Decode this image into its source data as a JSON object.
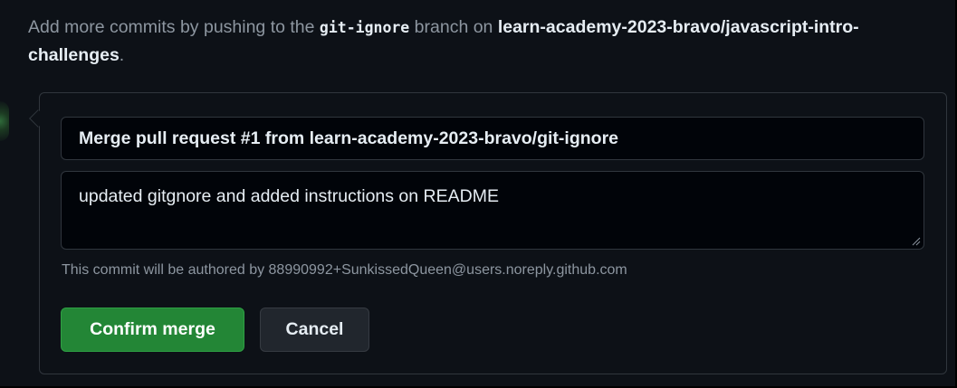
{
  "info": {
    "prefix": "Add more commits by pushing to the ",
    "branch": "git-ignore",
    "middle": " branch on ",
    "repo": "learn-academy-2023-bravo/javascript-intro-challenges",
    "suffix": "."
  },
  "merge_form": {
    "commit_title": "Merge pull request #1 from learn-academy-2023-bravo/git-ignore",
    "commit_message": "updated gitgnore and added instructions on README",
    "author_note": "This commit will be authored by 88990992+SunkissedQueen@users.noreply.github.com",
    "confirm_label": "Confirm merge",
    "cancel_label": "Cancel"
  },
  "colors": {
    "confirm_bg": "#238636",
    "cancel_bg": "#21262d",
    "page_bg": "#0d1117"
  },
  "icons": {
    "resize": "resize-grip-icon"
  }
}
